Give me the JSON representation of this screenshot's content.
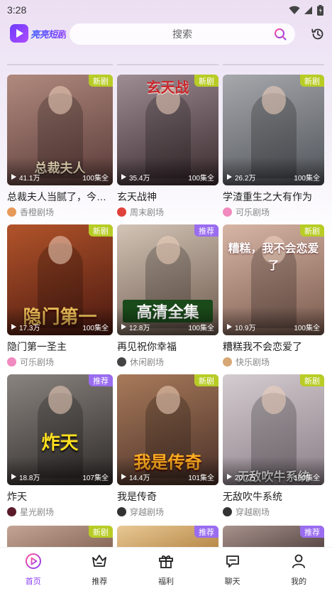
{
  "status": {
    "time": "3:28"
  },
  "header": {
    "logo_text": "亮亮短剧",
    "search_placeholder": "搜索"
  },
  "dramas": [
    {
      "title": "总裁夫人当腻了，今天离婚了",
      "views": "41.1万",
      "episodes": "100集全",
      "tag": "新剧",
      "tag_type": "new",
      "source": "香橙剧场",
      "poster_text": "总裁夫人",
      "colors": [
        "#5a3a38",
        "#b08a7e"
      ],
      "avatar_color": "#e89a5a"
    },
    {
      "title": "玄天战神",
      "views": "35.4万",
      "episodes": "100集全",
      "tag": "新剧",
      "tag_type": "new",
      "source": "周末剧场",
      "poster_text": "玄天战",
      "colors": [
        "#3a2a2e",
        "#9e8e94"
      ],
      "avatar_color": "#e0413a"
    },
    {
      "title": "学渣重生之大有作为",
      "views": "26.2万",
      "episodes": "100集全",
      "tag": "新剧",
      "tag_type": "new",
      "source": "可乐剧场",
      "poster_text": "",
      "colors": [
        "#50545a",
        "#a6a8ac"
      ],
      "avatar_color": "#f08abf"
    },
    {
      "title": "隐门第一圣主",
      "views": "17.3万",
      "episodes": "100集全",
      "tag": "新剧",
      "tag_type": "new",
      "source": "可乐剧场",
      "poster_text": "隐门第一",
      "colors": [
        "#4a1810",
        "#b2542a"
      ],
      "avatar_color": "#f08abf"
    },
    {
      "title": "再见祝你幸福",
      "views": "12.8万",
      "episodes": "100集全",
      "tag": "推荐",
      "tag_type": "rec",
      "source": "休闲剧场",
      "poster_text": "高清全集",
      "colors": [
        "#6e5a4e",
        "#d2c4b6"
      ],
      "avatar_color": "#444444"
    },
    {
      "title": "糟糕我不会恋爱了",
      "views": "10.9万",
      "episodes": "100集全",
      "tag": "新剧",
      "tag_type": "new",
      "source": "快乐剧场",
      "poster_text": "糟糕，我不会恋爱了",
      "colors": [
        "#7a5a4e",
        "#d8b6a6"
      ],
      "avatar_color": "#d7a774"
    },
    {
      "title": "炸天",
      "views": "18.8万",
      "episodes": "107集全",
      "tag": "推荐",
      "tag_type": "rec",
      "source": "星光剧场",
      "poster_text": "炸天",
      "colors": [
        "#2e2a28",
        "#8a8480"
      ],
      "avatar_color": "#5a1a2a"
    },
    {
      "title": "我是传奇",
      "views": "14.4万",
      "episodes": "101集全",
      "tag": "新剧",
      "tag_type": "new",
      "source": "穿越剧场",
      "poster_text": "我是传奇",
      "colors": [
        "#4a3028",
        "#a87a5a"
      ],
      "avatar_color": "#333333"
    },
    {
      "title": "无敌吹牛系统",
      "views": "20.7万",
      "episodes": "100集全",
      "tag": "新剧",
      "tag_type": "new",
      "source": "穿越剧场",
      "poster_text": "无敌吹牛系统",
      "colors": [
        "#8a7e86",
        "#d4ccd0"
      ],
      "avatar_color": "#333333"
    }
  ],
  "partial": [
    {
      "tag": "新剧",
      "tag_type": "new",
      "colors": [
        "#8a6a5a",
        "#c4a494"
      ]
    },
    {
      "tag": "推荐",
      "tag_type": "rec",
      "colors": [
        "#b88a4a",
        "#e8c894"
      ]
    },
    {
      "tag": "推荐",
      "tag_type": "rec",
      "colors": [
        "#5a4a48",
        "#a8928c"
      ]
    }
  ],
  "tabbar": {
    "tabs": [
      {
        "label": "首页",
        "icon": "home-play-icon",
        "active": true
      },
      {
        "label": "推荐",
        "icon": "crown-icon",
        "active": false
      },
      {
        "label": "福利",
        "icon": "gift-icon",
        "active": false
      },
      {
        "label": "聊天",
        "icon": "chat-icon",
        "active": false
      },
      {
        "label": "我的",
        "icon": "user-icon",
        "active": false
      }
    ]
  },
  "colors": {
    "accent": "#8a3df5",
    "tag_new": "#b8cc25",
    "tag_recommend": "#9a6cf0"
  }
}
